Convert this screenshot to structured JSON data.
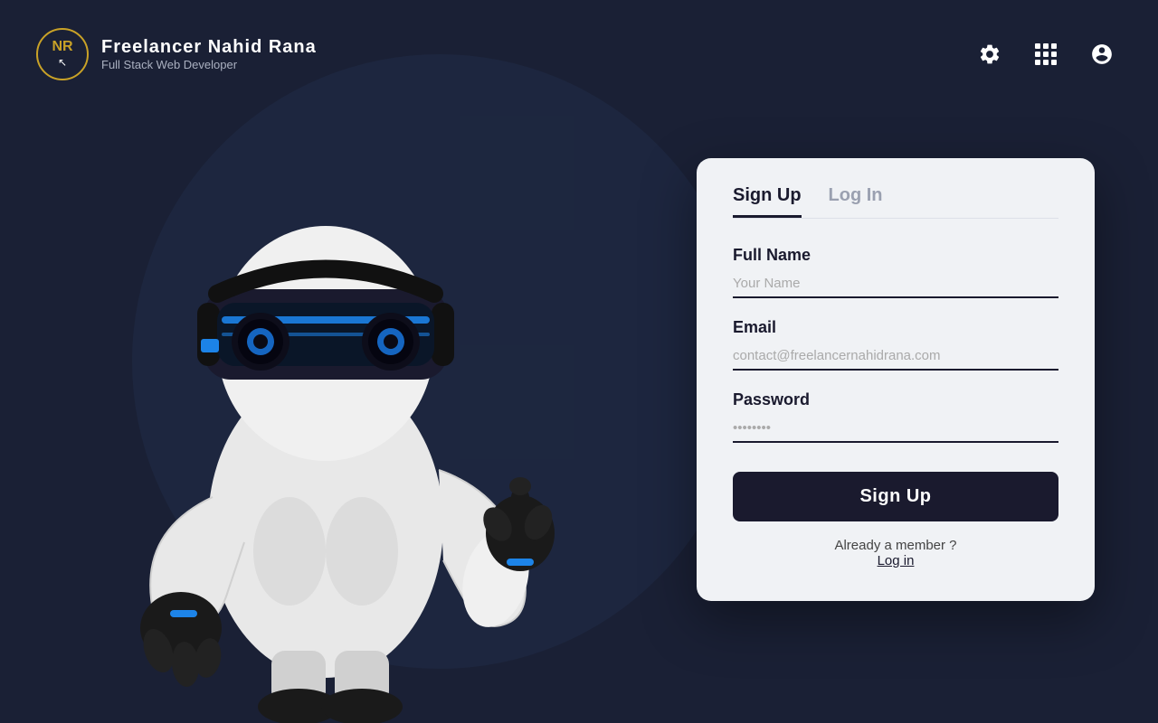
{
  "header": {
    "logo": {
      "initials": "NR",
      "cursor_symbol": "↖",
      "title": "Freelancer Nahid Rana",
      "subtitle": "Full Stack Web Developer"
    },
    "icons": {
      "settings_label": "⚙",
      "grid_label": "grid",
      "profile_label": "👤"
    }
  },
  "form": {
    "tab_signup": "Sign Up",
    "tab_login": "Log In",
    "full_name_label": "Full Name",
    "full_name_placeholder": "Your Name",
    "email_label": "Email",
    "email_placeholder": "contact@freelancernahidrana.com",
    "password_label": "Password",
    "password_placeholder": "••••••••",
    "signup_button": "Sign Up",
    "already_text": "Already a member ?",
    "login_link": "Log in"
  }
}
